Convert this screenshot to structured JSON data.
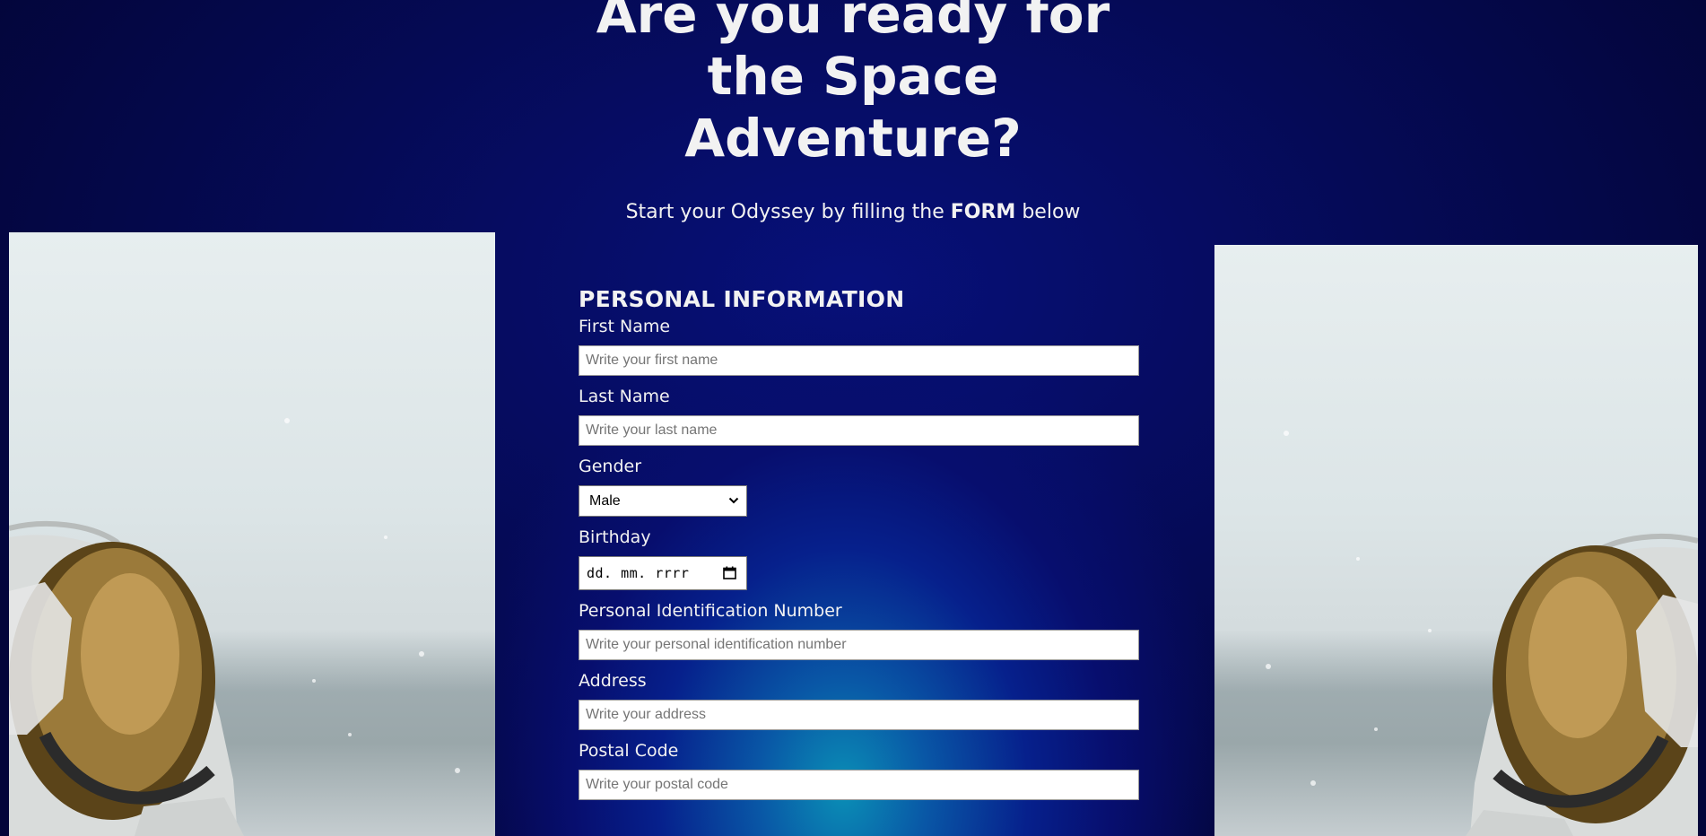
{
  "hero": {
    "title": "Are you ready for the Space Adventure?",
    "subtitle_prefix": "Start your Odyssey by filling the",
    "subtitle_emphasis": "FORM",
    "subtitle_suffix": "below"
  },
  "form": {
    "section_title": "PERSONAL INFORMATION",
    "fields": {
      "first_name": {
        "label": "First Name",
        "placeholder": "Write your first name",
        "value": ""
      },
      "last_name": {
        "label": "Last Name",
        "placeholder": "Write your last name",
        "value": ""
      },
      "gender": {
        "label": "Gender",
        "selected": "Male"
      },
      "birthday": {
        "label": "Birthday",
        "placeholder": "dd. mm. rrrr"
      },
      "pin": {
        "label": "Personal Identification Number",
        "placeholder": "Write your personal identification number",
        "value": ""
      },
      "address": {
        "label": "Address",
        "placeholder": "Write your address",
        "value": ""
      },
      "postal_code": {
        "label": "Postal Code",
        "placeholder": "Write your postal code",
        "value": ""
      }
    }
  },
  "icons": {
    "select_chevron": "chevron-down-icon",
    "calendar": "calendar-icon"
  },
  "colors": {
    "background_dark": "#04063e",
    "background_mid": "#07107a",
    "glow": "#0a8fb6",
    "text": "#f2f2f2"
  }
}
